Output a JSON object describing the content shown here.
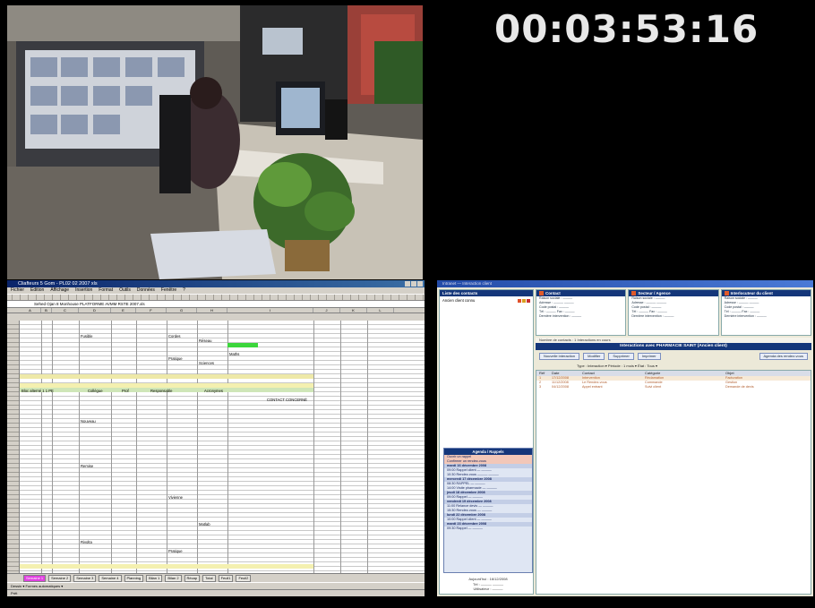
{
  "timecode": "00:03:53:16",
  "spreadsheet": {
    "title": "Cliafteurs 5 Gom - PL02 02 2007 xls",
    "menu": [
      "Fichier",
      "Edition",
      "Affichage",
      "Insertion",
      "Format",
      "Outils",
      "Données",
      "Fenêtre",
      "?"
    ],
    "formula_text": "Sehed Ojan 8 Monhouse PLATFORME AVMM RSTE 2007.xls",
    "columns": [
      "A",
      "B",
      "C",
      "D",
      "E",
      "F",
      "G",
      "H",
      "I",
      "J",
      "K",
      "L"
    ],
    "cells": {
      "r1": [
        "Fusible",
        "Cordes",
        "Réseau",
        "Maths"
      ],
      "r2": [
        "Pratique",
        "Sciences"
      ],
      "header_row": [
        "Bloc alterné 1 1 PE",
        "Collègue",
        "Prof",
        "Responsable",
        "Acronymes",
        "CONTACT CONCERNÉ"
      ],
      "labels": [
        "Nouveau",
        "Remise",
        "Vivienne",
        "Matlab",
        "Rivolta",
        "Pratique"
      ]
    },
    "sheet_tabs": [
      "Semaine 1",
      "Semaine 2",
      "Semaine 3",
      "Semaine 4",
      "Planning",
      "Bilan 1",
      "Bilan 2",
      "Récap",
      "Total",
      "Feuil1",
      "Feuil2"
    ],
    "active_tab": "Semaine 1",
    "drawbar": "Dessin ▾ Formes automatiques ▾",
    "status": "Prêt"
  },
  "crm": {
    "app_title": "Intranet — Interaction client",
    "left_header": "Liste des contacts",
    "left_item": "Ancien client connu",
    "cards": [
      {
        "title": "Contact",
        "lines": [
          "Raison sociale : ———",
          "Adresse : ——— ———",
          "Code postal : ———",
          "Tél : ——— Fax : ———",
          "Dernière intervention : ———"
        ]
      },
      {
        "title": "Secteur / Agence",
        "lines": [
          "Raison sociale : ———",
          "Adresse : ——— ———",
          "Code postal : ———",
          "Tél : ——— Fax : ———",
          "Dernière intervention : ———"
        ]
      },
      {
        "title": "Interlocuteur du client",
        "lines": [
          "Raison sociale : ———",
          "Adresse : ——— ———",
          "Code postal : ———",
          "Tél : ——— Fax : ———",
          "Dernière intervention : ———"
        ]
      }
    ],
    "interaction_bar": "Nombre de contacts : 1  Interactions en cours",
    "interaction_header": "Interactions avec PHARMACIE SAINT (Ancien client)",
    "buttons": [
      "Nouvelle interaction",
      "Modifier",
      "Supprimer",
      "Imprimer"
    ],
    "button_right": "Agenda des rendez-vous",
    "filter": "Type : Interaction ▾  Période : 1 mois ▾  État : Tous ▾",
    "history_columns": [
      "Réf",
      "Date",
      "Contact",
      "Catégorie",
      "Objet"
    ],
    "history_rows": [
      [
        "1",
        "17/12/2008",
        "Intervention",
        "Réclamation",
        "Facturation"
      ],
      [
        "2",
        "11/12/2008",
        "Le Rendez-vous",
        "Commande",
        "Gestion"
      ],
      [
        "3",
        "04/12/2008",
        "Appel entrant",
        "Suivi client",
        "Demande de devis"
      ]
    ],
    "agenda": {
      "title": "Agenda / Rappels",
      "rows": [
        {
          "t": "Ouvrir un rappel",
          "k": "hl"
        },
        {
          "t": "Confirmer un rendez-vous",
          "k": "hl"
        },
        {
          "t": "mardi 16 décembre 2008",
          "k": "day"
        },
        {
          "t": "09:00 Rappel client — ———",
          "k": ""
        },
        {
          "t": "10:30 Rendez-vous ——— ———",
          "k": ""
        },
        {
          "t": "mercredi 17 décembre 2008",
          "k": "day"
        },
        {
          "t": "08:30 RAPPEL — ———",
          "k": ""
        },
        {
          "t": "14:00 Visite pharmacie — ———",
          "k": ""
        },
        {
          "t": "jeudi 18 décembre 2008",
          "k": "day"
        },
        {
          "t": "09:00 Rappel — ———",
          "k": ""
        },
        {
          "t": "vendredi 19 décembre 2008",
          "k": "day"
        },
        {
          "t": "11:00 Relance devis — ———",
          "k": ""
        },
        {
          "t": "15:30 Rendez-vous — ———",
          "k": ""
        },
        {
          "t": "lundi 22 décembre 2008",
          "k": "day"
        },
        {
          "t": "10:00 Rappel client — ———",
          "k": ""
        },
        {
          "t": "mardi 23 décembre 2008",
          "k": "day"
        },
        {
          "t": "09:30 Rappel — ———",
          "k": ""
        }
      ]
    },
    "left_footer": [
      "Aujourd'hui : 16/12/2008",
      "Tél : ——— ———",
      "Utilisateur : ———"
    ]
  },
  "colors": {
    "titlebar": "#0a246a",
    "crm_header": "#14367a",
    "highlight_green": "#3bd63b",
    "tab_active": "#e040e0"
  }
}
